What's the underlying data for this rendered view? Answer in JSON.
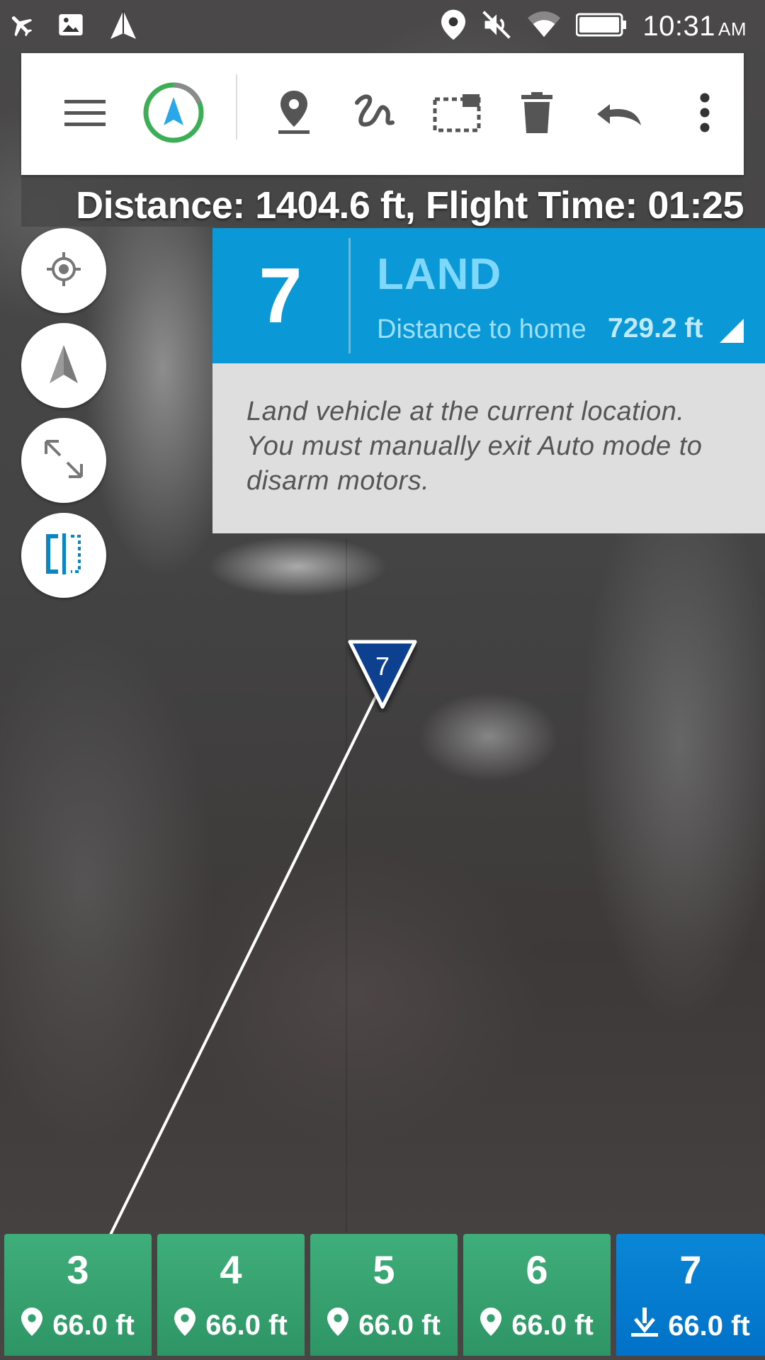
{
  "status_bar": {
    "left_icons": [
      "airplane-mode-icon",
      "image-icon",
      "navigation-arrow-icon"
    ],
    "right_icons": [
      "location-icon",
      "mute-icon",
      "wifi-icon",
      "battery-icon"
    ],
    "time": "10:31",
    "ampm": "AM"
  },
  "toolbar": {
    "items": [
      "menu-icon",
      "compass-navigation-icon",
      "add-waypoint-icon",
      "draw-spline-icon",
      "select-area-icon",
      "delete-icon",
      "undo-icon",
      "overflow-menu-icon"
    ]
  },
  "summary": {
    "text": "Distance: 1404.6 ft, Flight Time: 01:25"
  },
  "side_buttons": [
    "my-location-icon",
    "drone-location-icon",
    "fullscreen-icon",
    "split-view-icon"
  ],
  "info_panel": {
    "number": "7",
    "title": "LAND",
    "distance_label": "Distance to home",
    "distance_value": "729.2 ft",
    "description": "Land vehicle at the current location. You must manually exit Auto mode to disarm motors."
  },
  "map": {
    "marker_label": "7"
  },
  "waypoints": [
    {
      "number": "3",
      "altitude": "66.0 ft",
      "icon": "location-pin-icon",
      "active": false
    },
    {
      "number": "4",
      "altitude": "66.0 ft",
      "icon": "location-pin-icon",
      "active": false
    },
    {
      "number": "5",
      "altitude": "66.0 ft",
      "icon": "location-pin-icon",
      "active": false
    },
    {
      "number": "6",
      "altitude": "66.0 ft",
      "icon": "location-pin-icon",
      "active": false
    },
    {
      "number": "7",
      "altitude": "66.0 ft",
      "icon": "land-icon",
      "active": true
    }
  ],
  "colors": {
    "accent_blue": "#0b98d6",
    "waypoint_green": "#3fae7a",
    "active_blue": "#0072c8",
    "compass_ring_green": "#3cae55"
  }
}
